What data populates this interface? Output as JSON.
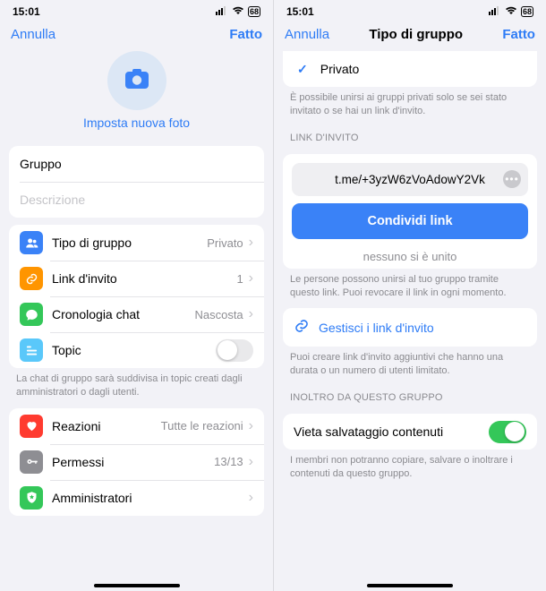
{
  "status": {
    "time": "15:01",
    "battery": "68"
  },
  "left": {
    "nav": {
      "cancel": "Annulla",
      "done": "Fatto"
    },
    "setPhoto": "Imposta nuova foto",
    "nameField": {
      "value": "Gruppo",
      "placeholder": "Descrizione"
    },
    "rows1": [
      {
        "icon": "group-type",
        "label": "Tipo di gruppo",
        "value": "Privato"
      },
      {
        "icon": "link",
        "label": "Link d'invito",
        "value": "1"
      },
      {
        "icon": "chat",
        "label": "Cronologia chat",
        "value": "Nascosta"
      },
      {
        "icon": "topic",
        "label": "Topic",
        "toggle": false
      }
    ],
    "note1": "La chat di gruppo sarà suddivisa in topic creati dagli amministratori o dagli utenti.",
    "rows2": [
      {
        "icon": "reactions",
        "label": "Reazioni",
        "value": "Tutte le reazioni"
      },
      {
        "icon": "permissions",
        "label": "Permessi",
        "value": "13/13"
      },
      {
        "icon": "admins",
        "label": "Amministratori",
        "value": ""
      }
    ]
  },
  "right": {
    "nav": {
      "cancel": "Annulla",
      "title": "Tipo di gruppo",
      "done": "Fatto"
    },
    "selected": "Privato",
    "selectedNote": "È possibile unirsi ai gruppi privati solo se sei stato invitato o se hai un link d'invito.",
    "inviteHead": "LINK D'INVITO",
    "inviteLink": "t.me/+3yzW6zVoAdowY2Vk",
    "shareBtn": "Condividi link",
    "joined": "nessuno si è unito",
    "inviteNote": "Le persone possono unirsi al tuo gruppo tramite questo link. Puoi revocare il link in ogni momento.",
    "manage": "Gestisci i link d'invito",
    "manageNote": "Puoi creare link d'invito aggiuntivi che hanno una durata o un numero di utenti limitato.",
    "forwardHead": "INOLTRO DA QUESTO GRUPPO",
    "forbidSave": {
      "label": "Vieta salvataggio contenuti",
      "on": true
    },
    "forbidNote": "I membri non potranno copiare, salvare o inoltrare i contenuti da questo gruppo."
  }
}
